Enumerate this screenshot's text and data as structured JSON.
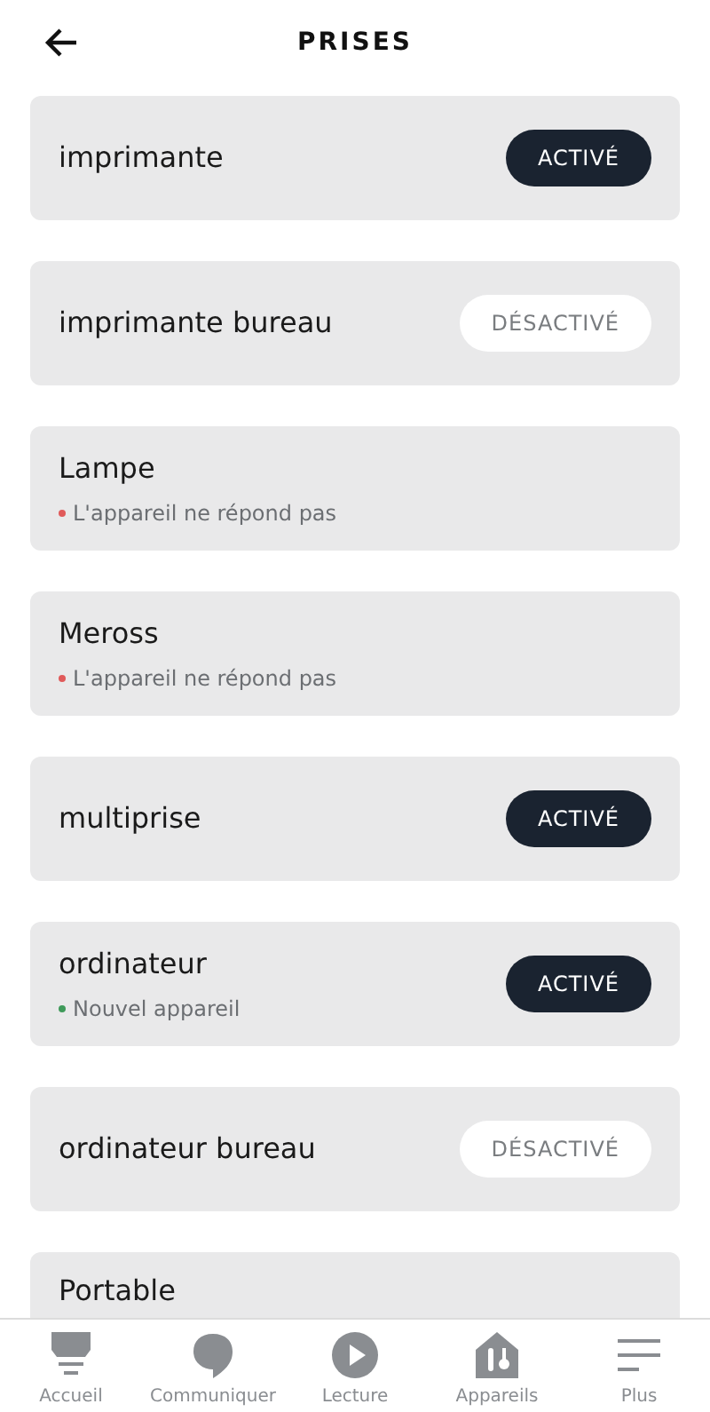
{
  "header": {
    "title": "PRISES"
  },
  "devices": [
    {
      "name": "imprimante",
      "toggle": {
        "label": "ACTIVÉ",
        "on": true
      }
    },
    {
      "name": "imprimante bureau",
      "toggle": {
        "label": "DÉSACTIVÉ",
        "on": false
      }
    },
    {
      "name": "Lampe",
      "status": {
        "text": "L'appareil ne répond pas",
        "color": "#e05a5a"
      }
    },
    {
      "name": "Meross",
      "status": {
        "text": "L'appareil ne répond pas",
        "color": "#e05a5a"
      }
    },
    {
      "name": "multiprise",
      "toggle": {
        "label": "ACTIVÉ",
        "on": true
      }
    },
    {
      "name": "ordinateur",
      "status": {
        "text": "Nouvel appareil",
        "color": "#3f9a5a"
      },
      "toggle": {
        "label": "ACTIVÉ",
        "on": true
      }
    },
    {
      "name": "ordinateur bureau",
      "toggle": {
        "label": "DÉSACTIVÉ",
        "on": false
      }
    },
    {
      "name": "Portable"
    }
  ],
  "nav": [
    {
      "kind": "home",
      "label": "Accueil"
    },
    {
      "kind": "chat",
      "label": "Communiquer"
    },
    {
      "kind": "play",
      "label": "Lecture"
    },
    {
      "kind": "devices",
      "label": "Appareils"
    },
    {
      "kind": "more",
      "label": "Plus"
    }
  ]
}
